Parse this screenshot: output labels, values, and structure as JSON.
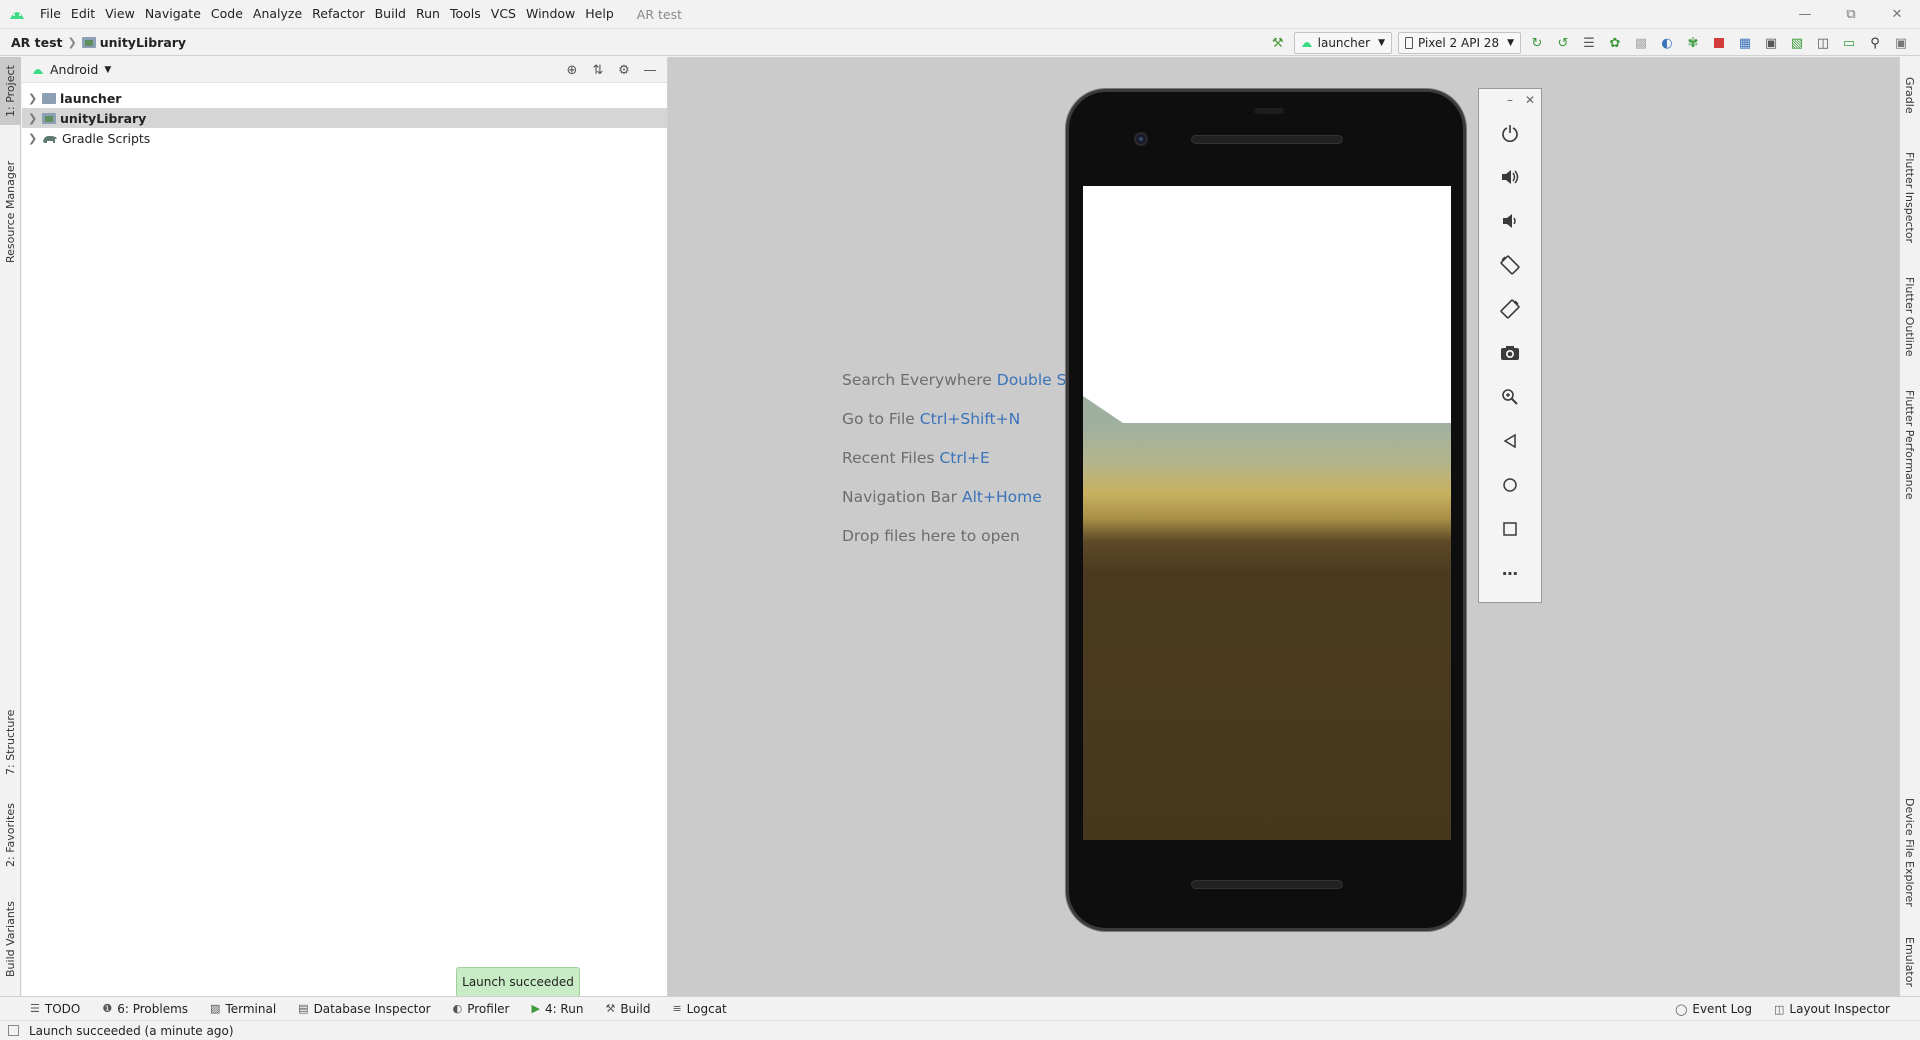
{
  "menubar": {
    "items": [
      "File",
      "Edit",
      "View",
      "Navigate",
      "Code",
      "Analyze",
      "Refactor",
      "Build",
      "Run",
      "Tools",
      "VCS",
      "Window",
      "Help"
    ],
    "project_title": "AR test",
    "window_controls": [
      "minimize-icon",
      "restore-icon",
      "close-icon"
    ]
  },
  "navbar": {
    "project": "AR test",
    "module": "unityLibrary",
    "run_config": "launcher",
    "device": "Pixel 2 API 28"
  },
  "left_stripe": {
    "tabs": [
      "1: Project",
      "Resource Manager",
      "7: Structure",
      "2: Favorites",
      "Build Variants"
    ]
  },
  "right_stripe": {
    "tabs": [
      "Gradle",
      "Flutter Inspector",
      "Flutter Outline",
      "Flutter Performance",
      "Device File Explorer",
      "Emulator"
    ]
  },
  "project_panel": {
    "view_mode": "Android",
    "tree": [
      {
        "label": "launcher",
        "bold": true
      },
      {
        "label": "unityLibrary",
        "bold": true,
        "selected": true
      },
      {
        "label": "Gradle Scripts",
        "bold": false
      }
    ]
  },
  "editor_hints": [
    {
      "text": "Search Everywhere",
      "key": "Double Shift"
    },
    {
      "text": "Go to File",
      "key": "Ctrl+Shift+N"
    },
    {
      "text": "Recent Files",
      "key": "Ctrl+E"
    },
    {
      "text": "Navigation Bar",
      "key": "Alt+Home"
    },
    {
      "text": "Drop files here to open",
      "key": ""
    }
  ],
  "emulator_controls": [
    "power-icon",
    "volume-up-icon",
    "volume-down-icon",
    "rotate-left-icon",
    "rotate-right-icon",
    "camera-icon",
    "zoom-icon",
    "back-icon",
    "home-icon",
    "overview-icon",
    "more-icon"
  ],
  "bottom_tools": {
    "left": [
      {
        "label": "TODO",
        "icon": "list-icon"
      },
      {
        "label": "6: Problems",
        "icon": "info-icon"
      },
      {
        "label": "Terminal",
        "icon": "terminal-icon"
      },
      {
        "label": "Database Inspector",
        "icon": "database-icon"
      },
      {
        "label": "Profiler",
        "icon": "gauge-icon"
      },
      {
        "label": "4: Run",
        "icon": "run-icon"
      },
      {
        "label": "Build",
        "icon": "hammer-icon"
      },
      {
        "label": "Logcat",
        "icon": "log-icon"
      }
    ],
    "right": [
      {
        "label": "Event Log",
        "icon": "chat-icon"
      },
      {
        "label": "Layout Inspector",
        "icon": "layout-icon"
      }
    ]
  },
  "balloon": {
    "text": "Launch succeeded"
  },
  "status": {
    "text": "Launch succeeded (a minute ago)"
  },
  "colors": {
    "accent_link": "#3a73b9",
    "balloon_bg": "#c8ecc5",
    "android_green": "#3ddc84"
  }
}
